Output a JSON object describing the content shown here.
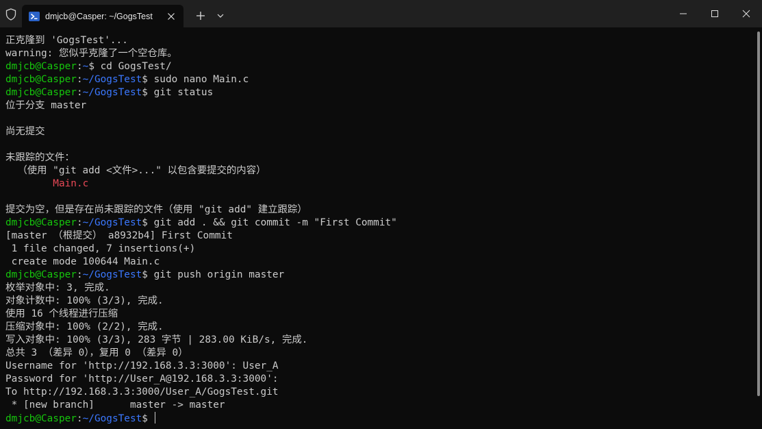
{
  "window": {
    "tab_title": "dmjcb@Casper: ~/GogsTest"
  },
  "prompt": {
    "user_host": "dmjcb@Casper",
    "sep": ":",
    "path_home": "~",
    "path_repo": "~/GogsTest",
    "dollar": "$"
  },
  "colors": {
    "background": "#0c0c0c",
    "text": "#cccccc",
    "user_host": "#16c60c",
    "path": "#3b78ff",
    "untracked": "#e74856"
  },
  "lines": {
    "l1": "正克隆到 'GogsTest'...",
    "l2": "warning: 您似乎克隆了一个空仓库。",
    "l3_cmd": " cd GogsTest/",
    "l4_cmd": " sudo nano Main.c",
    "l5_cmd": " git status",
    "l6": "位于分支 master",
    "l7": "",
    "l8": "尚无提交",
    "l9": "",
    "l10": "未跟踪的文件：",
    "l11": "  （使用 \"git add <文件>...\" 以包含要提交的内容）",
    "l12": "        Main.c",
    "l13": "",
    "l14": "提交为空，但是存在尚未跟踪的文件（使用 \"git add\" 建立跟踪）",
    "l15_cmd": " git add . && git commit -m \"First Commit\"",
    "l16": "[master （根提交） a8932b4] First Commit",
    "l17": " 1 file changed, 7 insertions(+)",
    "l18": " create mode 100644 Main.c",
    "l19_cmd": " git push origin master",
    "l20": "枚举对象中: 3, 完成.",
    "l21": "对象计数中: 100% (3/3), 完成.",
    "l22": "使用 16 个线程进行压缩",
    "l23": "压缩对象中: 100% (2/2), 完成.",
    "l24": "写入对象中: 100% (3/3), 283 字节 | 283.00 KiB/s, 完成.",
    "l25": "总共 3 （差异 0），复用 0 （差异 0）",
    "l26": "Username for 'http://192.168.3.3:3000': User_A",
    "l27": "Password for 'http://User_A@192.168.3.3:3000':",
    "l28": "To http://192.168.3.3:3000/User_A/GogsTest.git",
    "l29": " * [new branch]      master -> master",
    "l30_cmd": " "
  }
}
